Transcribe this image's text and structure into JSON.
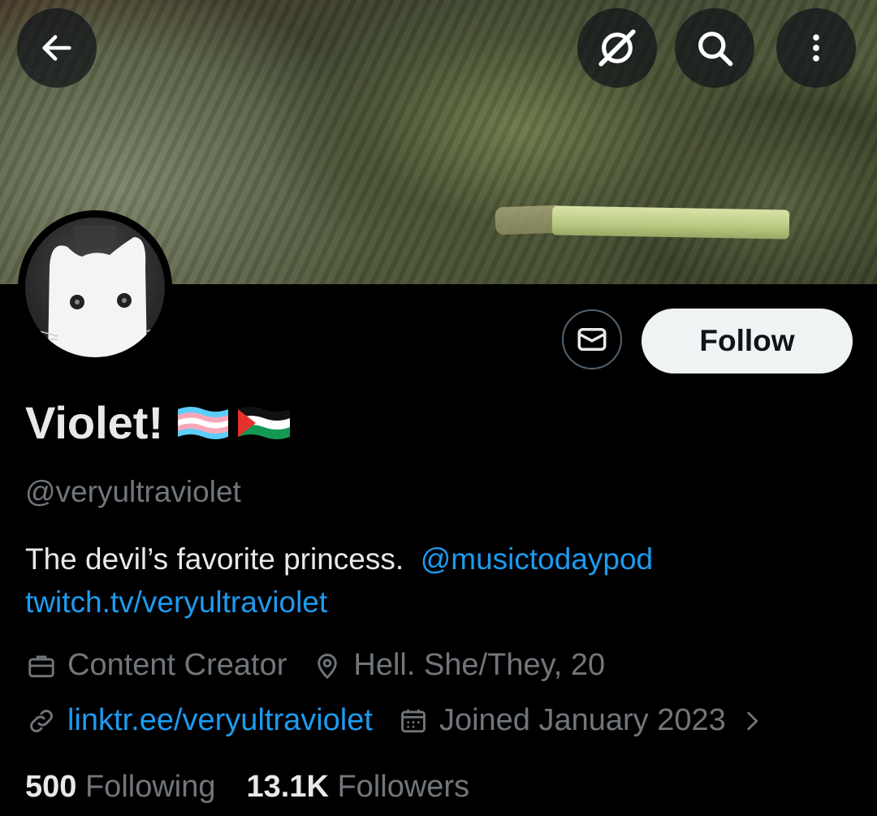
{
  "profile": {
    "display_name": "Violet!",
    "flags": [
      "transgender-flag",
      "palestine-flag"
    ],
    "handle": "@veryultraviolet",
    "bio_text": "The devil’s favorite princess.",
    "bio_mention": "@musictodaypod",
    "bio_link": "twitch.tv/veryultraviolet",
    "category": "Content Creator",
    "location": "Hell. She/They, 20",
    "website": "linktr.ee/veryultraviolet",
    "joined": "Joined January 2023"
  },
  "actions": {
    "follow_label": "Follow"
  },
  "stats": {
    "following_count": "500",
    "following_label": "Following",
    "followers_count": "13.1K",
    "followers_label": "Followers"
  },
  "icons": {
    "back": "back-arrow-icon",
    "grok": "grok-icon",
    "search": "search-icon",
    "more": "more-vertical-icon",
    "message": "envelope-icon",
    "category": "briefcase-icon",
    "location": "location-pin-icon",
    "website": "link-icon",
    "joined": "calendar-icon",
    "chevron": "chevron-right-icon"
  },
  "colors": {
    "background": "#000000",
    "text_primary": "#e7e9ea",
    "text_secondary": "#71767b",
    "link": "#1d9bf0",
    "follow_button_bg": "#eff3f4"
  }
}
